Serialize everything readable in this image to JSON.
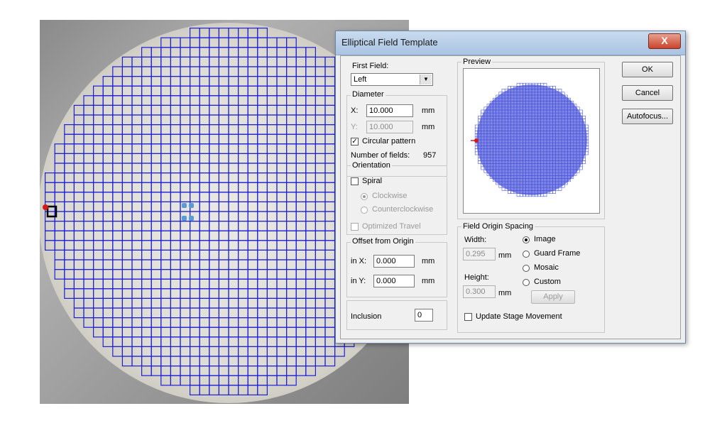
{
  "dialog": {
    "title": "Elliptical Field Template",
    "close_glyph": "X",
    "first_field": {
      "label": "First Field:",
      "value": "Left"
    },
    "diameter": {
      "label": "Diameter",
      "x_label": "X:",
      "x_value": "10.000",
      "x_unit": "mm",
      "y_label": "Y:",
      "y_value": "10.000",
      "y_unit": "mm",
      "circular_label": "Circular pattern",
      "circular_checked": true,
      "num_fields_label": "Number of fields:",
      "num_fields_value": "957"
    },
    "orientation": {
      "label": "Orientation",
      "spiral_label": "Spiral",
      "clockwise_label": "Clockwise",
      "counterclockwise_label": "Counterclockwise",
      "optimized_label": "Optimized Travel"
    },
    "offset": {
      "label": "Offset from Origin",
      "x_label": "in X:",
      "x_value": "0.000",
      "x_unit": "mm",
      "y_label": "in Y:",
      "y_value": "0.000",
      "y_unit": "mm"
    },
    "inclusion": {
      "label": "Inclusion",
      "value": "0"
    },
    "preview": {
      "label": "Preview"
    },
    "spacing": {
      "label": "Field Origin Spacing",
      "width_label": "Width:",
      "width_value": "0.295",
      "width_unit": "mm",
      "height_label": "Height:",
      "height_value": "0.300",
      "height_unit": "mm",
      "options": [
        "Image",
        "Guard Frame",
        "Mosaic",
        "Custom"
      ],
      "selected": "Image",
      "apply_label": "Apply",
      "update_label": "Update Stage Movement"
    },
    "buttons": {
      "ok": "OK",
      "cancel": "Cancel",
      "autofocus": "Autofocus..."
    }
  },
  "colors": {
    "grid": "#1f1fd6",
    "preview_grid": "#4a55d8",
    "marker": "#d11a1a",
    "selection": "#5b9bd5"
  }
}
